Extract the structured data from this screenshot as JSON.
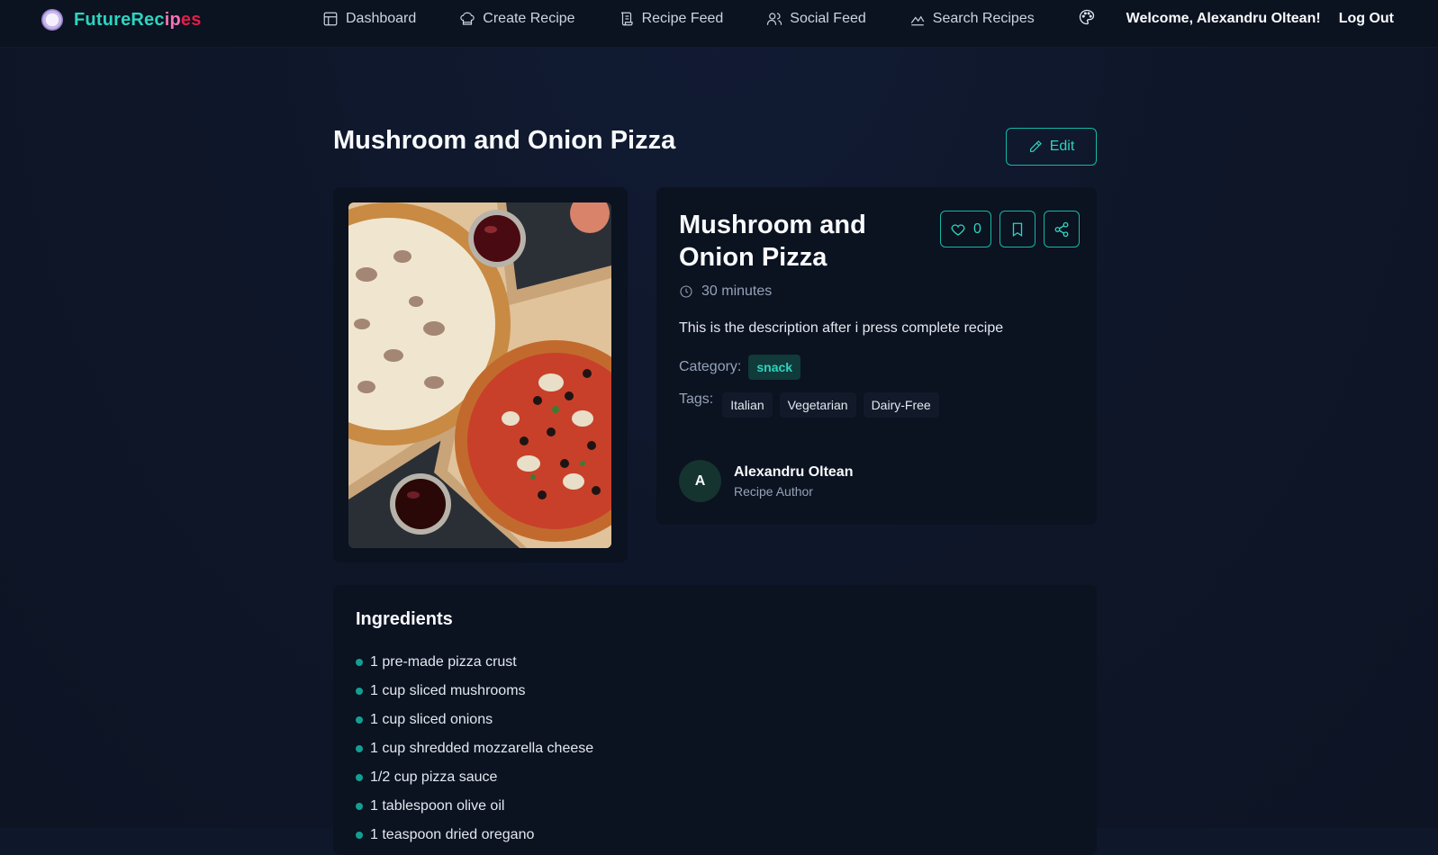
{
  "brand": {
    "name_part1": "FutureRec",
    "name_part2": "ip",
    "name_part3": "es",
    "accent": "#2dd4bf"
  },
  "nav": {
    "items": [
      {
        "label": "Dashboard",
        "icon": "layout-icon"
      },
      {
        "label": "Create Recipe",
        "icon": "chef-hat-icon"
      },
      {
        "label": "Recipe Feed",
        "icon": "scroll-icon"
      },
      {
        "label": "Social Feed",
        "icon": "users-icon"
      },
      {
        "label": "Search Recipes",
        "icon": "chart-search-icon"
      }
    ],
    "welcome": "Welcome, Alexandru Oltean!",
    "logout": "Log Out"
  },
  "page": {
    "title": "Mushroom and Onion Pizza",
    "edit_label": "Edit"
  },
  "recipe": {
    "name": "Mushroom and Onion Pizza",
    "likes": "0",
    "time": "30 minutes",
    "description": "This is the description after i press complete recipe",
    "category_label": "Category:",
    "category": "snack",
    "tags_label": "Tags:",
    "tags": [
      "Italian",
      "Vegetarian",
      "Dairy-Free"
    ],
    "author": {
      "initial": "A",
      "name": "Alexandru Oltean",
      "role": "Recipe Author"
    }
  },
  "ingredients": {
    "title": "Ingredients",
    "items": [
      "1 pre-made pizza crust",
      "1 cup sliced mushrooms",
      "1 cup sliced onions",
      "1 cup shredded mozzarella cheese",
      "1/2 cup pizza sauce",
      "1 tablespoon olive oil",
      "1 teaspoon dried oregano"
    ]
  }
}
